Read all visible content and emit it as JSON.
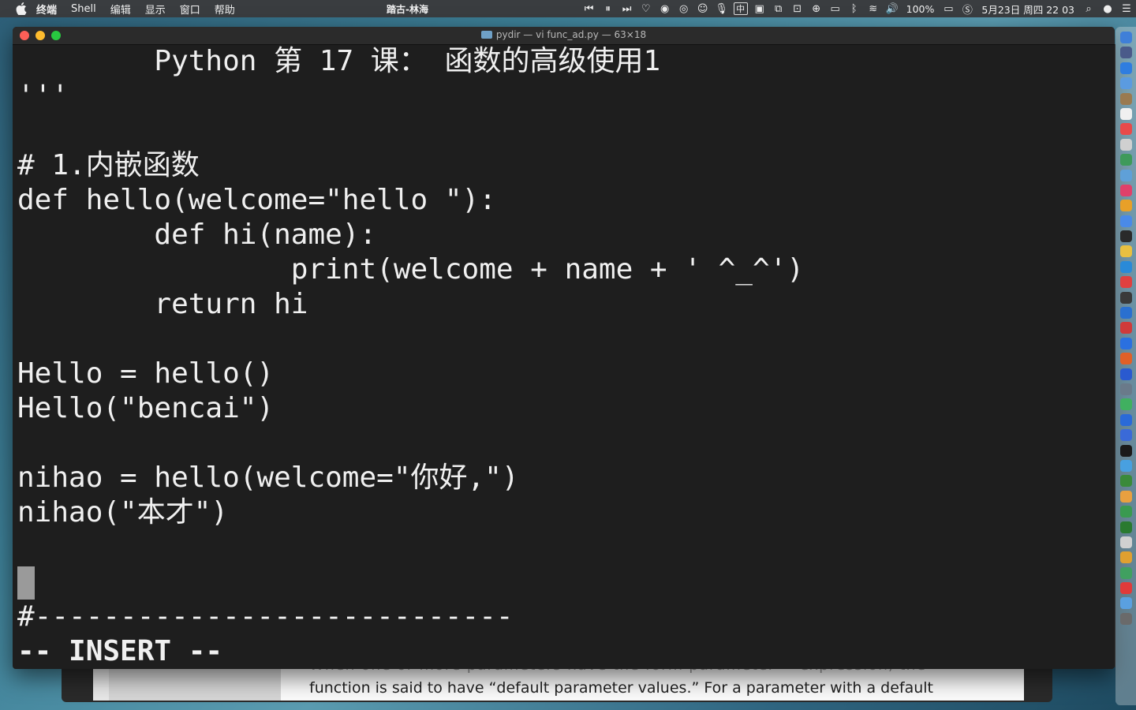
{
  "menubar": {
    "app_name": "终端",
    "items": [
      "Shell",
      "编辑",
      "显示",
      "窗口",
      "帮助"
    ],
    "now_playing": "踏古-林海",
    "status_input": "中",
    "battery": "100%",
    "datetime": "5月23日 周四  22 03"
  },
  "terminal": {
    "title": "pydir — vi func_ad.py — 63×18",
    "lines": [
      "        Python 第 17 课： 函数的高级使用1",
      "'''",
      "",
      "# 1.内嵌函数",
      "def hello(welcome=\"hello \"):",
      "        def hi(name):",
      "                print(welcome + name + ' ^_^')",
      "        return hi",
      "",
      "Hello = hello()",
      "Hello(\"bencai\")",
      "",
      "nihao = hello(welcome=\"你好,\")",
      "nihao(\"本才\")",
      "",
      "",
      "#----------------------------",
      "-- INSERT --"
    ]
  },
  "background_window": {
    "partial_line": "When one or more parameters have the form parameter = expression, the",
    "visible_line": "function is said to have “default parameter values.” For a parameter with a default"
  },
  "dock": {
    "colors": [
      "#3f7fd8",
      "#4a5a8a",
      "#2f7de0",
      "#5b9be0",
      "#9a7a50",
      "#f0f0f0",
      "#e84a4a",
      "#d0d0d0",
      "#3e9a5a",
      "#5fa0d8",
      "#e0406a",
      "#e8a028",
      "#4a8ae8",
      "#2a2a2a",
      "#e8c040",
      "#2a8ad8",
      "#e04040",
      "#3a3a3a",
      "#2a70d0",
      "#d03a3a",
      "#2a70e0",
      "#e06028",
      "#2a5ad0",
      "#6a7a8a",
      "#40b060",
      "#2a6ad8",
      "#3a6ad8",
      "#1a1a1a",
      "#48a0e0",
      "#3a8a3a",
      "#e8a040",
      "#3a9a50",
      "#2a7a30",
      "#d0d0d0",
      "#e0a030",
      "#40a060",
      "#e03a3a",
      "#5aa0e0",
      "#6a6a6a"
    ]
  }
}
